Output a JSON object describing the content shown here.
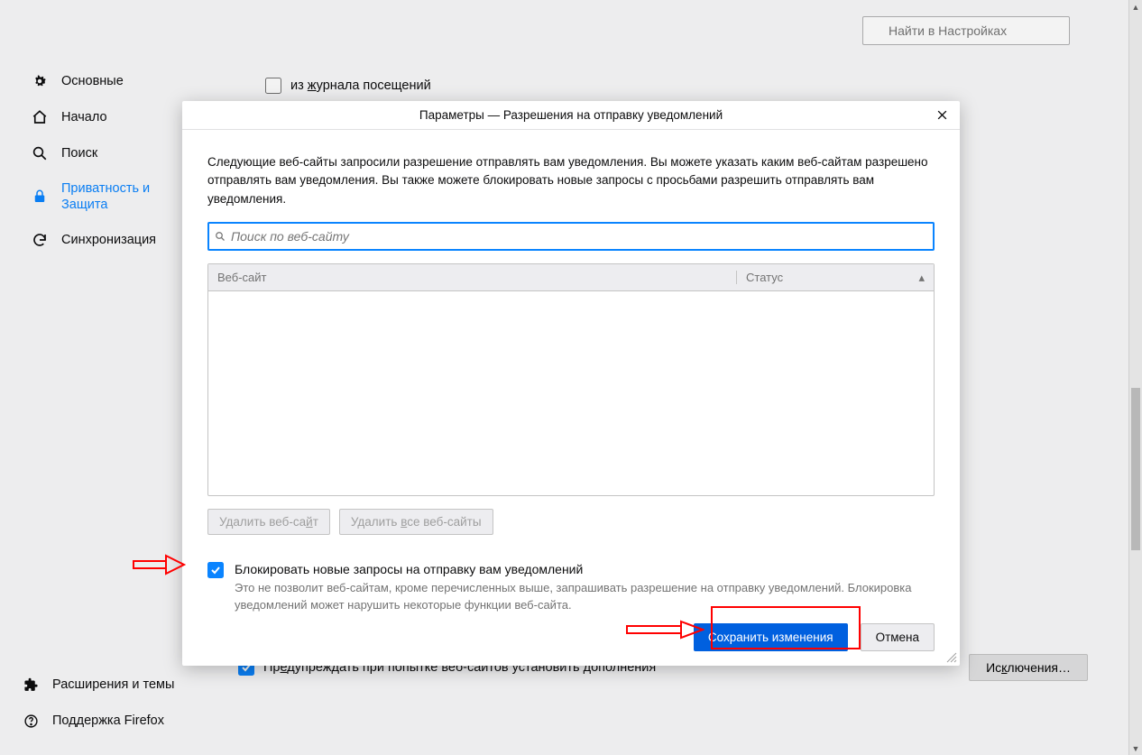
{
  "sidebar": {
    "items": [
      {
        "label": "Основные",
        "icon": "gear"
      },
      {
        "label": "Начало",
        "icon": "home"
      },
      {
        "label": "Поиск",
        "icon": "search"
      },
      {
        "label": "Приватность и Защита",
        "icon": "lock"
      },
      {
        "label": "Синхронизация",
        "icon": "sync"
      }
    ],
    "bottom": [
      {
        "label": "Расширения и темы",
        "icon": "puzzle"
      },
      {
        "label": "Поддержка Firefox",
        "icon": "help"
      }
    ]
  },
  "main": {
    "search_placeholder": "Найти в Настройках",
    "row_history": "из журнала посещений",
    "row_addons": "Предупреждать при попытке веб-сайтов установить дополнения",
    "exceptions_btn": "Исключения…"
  },
  "dialog": {
    "title": "Параметры — Разрешения на отправку уведомлений",
    "description": "Следующие веб-сайты запросили разрешение отправлять вам уведомления. Вы можете указать каким веб-сайтам разрешено отправлять вам уведомления. Вы также можете блокировать новые запросы с просьбами разрешить отправлять вам уведомления.",
    "search_placeholder": "Поиск по веб-сайту",
    "col_site": "Веб-сайт",
    "col_status": "Статус",
    "remove_site": "Удалить веб-сайт",
    "remove_all": "Удалить все веб-сайты",
    "block_title": "Блокировать новые запросы на отправку вам уведомлений",
    "block_note": "Это не позволит веб-сайтам, кроме перечисленных выше, запрашивать разрешение на отправку уведомлений. Блокировка уведомлений может нарушить некоторые функции веб-сайта.",
    "save": "Сохранить изменения",
    "cancel": "Отмена"
  }
}
